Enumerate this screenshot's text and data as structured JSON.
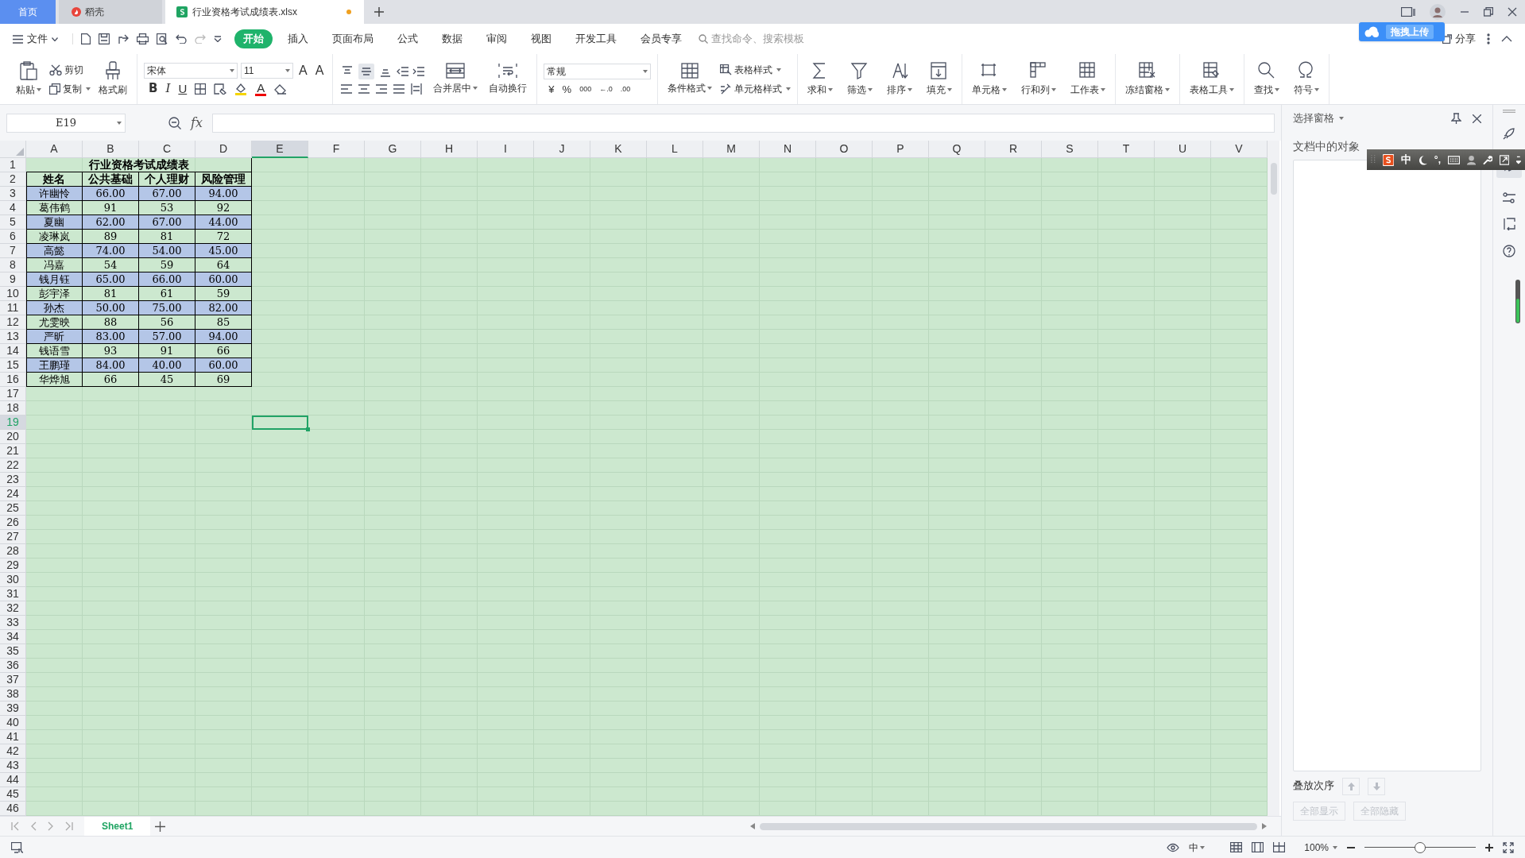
{
  "title_tabs": [
    {
      "label": "首页",
      "selected": false,
      "kind": "home"
    },
    {
      "label": "稻壳",
      "selected": false,
      "kind": "docer"
    },
    {
      "label": "行业资格考试成绩表.xlsx",
      "selected": true,
      "kind": "sheet",
      "modified": true
    }
  ],
  "menu": {
    "file": "文件",
    "items": [
      {
        "label": "开始",
        "selected": true
      },
      {
        "label": "插入",
        "selected": false
      },
      {
        "label": "页面布局",
        "selected": false
      },
      {
        "label": "公式",
        "selected": false
      },
      {
        "label": "数据",
        "selected": false
      },
      {
        "label": "审阅",
        "selected": false
      },
      {
        "label": "视图",
        "selected": false
      },
      {
        "label": "开发工具",
        "selected": false
      },
      {
        "label": "会员专享",
        "selected": false
      }
    ],
    "search": {
      "placeholder": "查找命令、搜索模板"
    },
    "upload": "拖拽上传",
    "share": "分享"
  },
  "ribbon": {
    "paste": "粘贴",
    "cut": "剪切",
    "copy": "复制",
    "format_painter": "格式刷",
    "font": "宋体",
    "font_size": "11",
    "grow": "A",
    "shrink": "A",
    "styles": [
      "B",
      "I",
      "U"
    ],
    "font_color": "A",
    "vertical_align": [
      {
        "selected": false
      },
      {
        "selected": true
      },
      {
        "selected": false
      }
    ],
    "merge": "合并居中",
    "wrap": "自动换行",
    "number_format": "常规",
    "number_buttons": [
      "¥",
      "%",
      "000",
      "←.0",
      ".00"
    ],
    "conditional": "条件格式",
    "table_style": "表格样式",
    "cell_style": "单元格样式",
    "tools": [
      {
        "label": "求和"
      },
      {
        "label": "筛选"
      },
      {
        "label": "排序"
      },
      {
        "label": "填充"
      },
      {
        "label": "单元格"
      },
      {
        "label": "行和列"
      },
      {
        "label": "工作表"
      },
      {
        "label": "冻结窗格"
      },
      {
        "label": "表格工具"
      },
      {
        "label": "查找"
      },
      {
        "label": "符号"
      }
    ]
  },
  "formula_bar": {
    "name_box": "E19",
    "fx": "fx"
  },
  "columns": [
    {
      "label": "A",
      "selected": false
    },
    {
      "label": "B",
      "selected": false
    },
    {
      "label": "C",
      "selected": false
    },
    {
      "label": "D",
      "selected": false
    },
    {
      "label": "E",
      "selected": true
    },
    {
      "label": "F",
      "selected": false
    },
    {
      "label": "G",
      "selected": false
    },
    {
      "label": "H",
      "selected": false
    },
    {
      "label": "I",
      "selected": false
    },
    {
      "label": "J",
      "selected": false
    },
    {
      "label": "K",
      "selected": false
    },
    {
      "label": "L",
      "selected": false
    },
    {
      "label": "M",
      "selected": false
    },
    {
      "label": "N",
      "selected": false
    },
    {
      "label": "O",
      "selected": false
    },
    {
      "label": "P",
      "selected": false
    },
    {
      "label": "Q",
      "selected": false
    },
    {
      "label": "R",
      "selected": false
    },
    {
      "label": "S",
      "selected": false
    },
    {
      "label": "T",
      "selected": false
    },
    {
      "label": "U",
      "selected": false
    },
    {
      "label": "V",
      "selected": false
    }
  ],
  "row_headers": [
    {
      "label": "1",
      "selected": false
    },
    {
      "label": "2",
      "selected": false
    },
    {
      "label": "3",
      "selected": false
    },
    {
      "label": "4",
      "selected": false
    },
    {
      "label": "5",
      "selected": false
    },
    {
      "label": "6",
      "selected": false
    },
    {
      "label": "7",
      "selected": false
    },
    {
      "label": "8",
      "selected": false
    },
    {
      "label": "9",
      "selected": false
    },
    {
      "label": "10",
      "selected": false
    },
    {
      "label": "11",
      "selected": false
    },
    {
      "label": "12",
      "selected": false
    },
    {
      "label": "13",
      "selected": false
    },
    {
      "label": "14",
      "selected": false
    },
    {
      "label": "15",
      "selected": false
    },
    {
      "label": "16",
      "selected": false
    },
    {
      "label": "17",
      "selected": false
    },
    {
      "label": "18",
      "selected": false
    },
    {
      "label": "19",
      "selected": true
    },
    {
      "label": "20",
      "selected": false
    },
    {
      "label": "21",
      "selected": false
    },
    {
      "label": "22",
      "selected": false
    },
    {
      "label": "23",
      "selected": false
    },
    {
      "label": "24",
      "selected": false
    },
    {
      "label": "25",
      "selected": false
    },
    {
      "label": "26",
      "selected": false
    },
    {
      "label": "27",
      "selected": false
    },
    {
      "label": "28",
      "selected": false
    },
    {
      "label": "29",
      "selected": false
    },
    {
      "label": "30",
      "selected": false
    },
    {
      "label": "31",
      "selected": false
    },
    {
      "label": "32",
      "selected": false
    },
    {
      "label": "33",
      "selected": false
    },
    {
      "label": "34",
      "selected": false
    },
    {
      "label": "35",
      "selected": false
    },
    {
      "label": "36",
      "selected": false
    },
    {
      "label": "37",
      "selected": false
    },
    {
      "label": "38",
      "selected": false
    },
    {
      "label": "39",
      "selected": false
    },
    {
      "label": "40",
      "selected": false
    },
    {
      "label": "41",
      "selected": false
    },
    {
      "label": "42",
      "selected": false
    },
    {
      "label": "43",
      "selected": false
    },
    {
      "label": "44",
      "selected": false
    },
    {
      "label": "45",
      "selected": false
    },
    {
      "label": "46",
      "selected": false
    }
  ],
  "sheet": {
    "title": "行业资格考试成绩表",
    "header": [
      "姓名",
      "公共基础",
      "个人理财",
      "风险管理"
    ],
    "rows": [
      {
        "cells": [
          "许幽怜",
          "66.00",
          "67.00",
          "94.00"
        ],
        "highlighted": true
      },
      {
        "cells": [
          "葛伟鹤",
          "91",
          "53",
          "92"
        ],
        "highlighted": false
      },
      {
        "cells": [
          "夏幽",
          "62.00",
          "67.00",
          "44.00"
        ],
        "highlighted": true
      },
      {
        "cells": [
          "凌琳岚",
          "89",
          "81",
          "72"
        ],
        "highlighted": false
      },
      {
        "cells": [
          "高懿",
          "74.00",
          "54.00",
          "45.00"
        ],
        "highlighted": true
      },
      {
        "cells": [
          "冯嘉",
          "54",
          "59",
          "64"
        ],
        "highlighted": false
      },
      {
        "cells": [
          "钱月钰",
          "65.00",
          "66.00",
          "60.00"
        ],
        "highlighted": true
      },
      {
        "cells": [
          "彭宇泽",
          "81",
          "61",
          "59"
        ],
        "highlighted": false
      },
      {
        "cells": [
          "孙杰",
          "50.00",
          "75.00",
          "82.00"
        ],
        "highlighted": true
      },
      {
        "cells": [
          "尤雯映",
          "88",
          "56",
          "85"
        ],
        "highlighted": false
      },
      {
        "cells": [
          "严昕",
          "83.00",
          "57.00",
          "94.00"
        ],
        "highlighted": true
      },
      {
        "cells": [
          "钱语雪",
          "93",
          "91",
          "66"
        ],
        "highlighted": false
      },
      {
        "cells": [
          "王鹏瑾",
          "84.00",
          "40.00",
          "60.00"
        ],
        "highlighted": true
      },
      {
        "cells": [
          "华烨旭",
          "66",
          "45",
          "69"
        ],
        "highlighted": false
      }
    ]
  },
  "sheet_tabs": [
    {
      "label": "Sheet1",
      "selected": true
    }
  ],
  "selection_pane": {
    "title": "选择窗格",
    "objects_label": "文档中的对象",
    "order_label": "叠放次序",
    "buttons": [
      {
        "label": "全部显示",
        "disabled": true
      },
      {
        "label": "全部隐藏",
        "disabled": true
      }
    ]
  },
  "ime_toolbar": {
    "mode": "中",
    "punctuation": "°,"
  },
  "status_bar": {
    "ime": "中",
    "zoom": "100%",
    "zoom_slider": {
      "level": 0.5
    }
  }
}
